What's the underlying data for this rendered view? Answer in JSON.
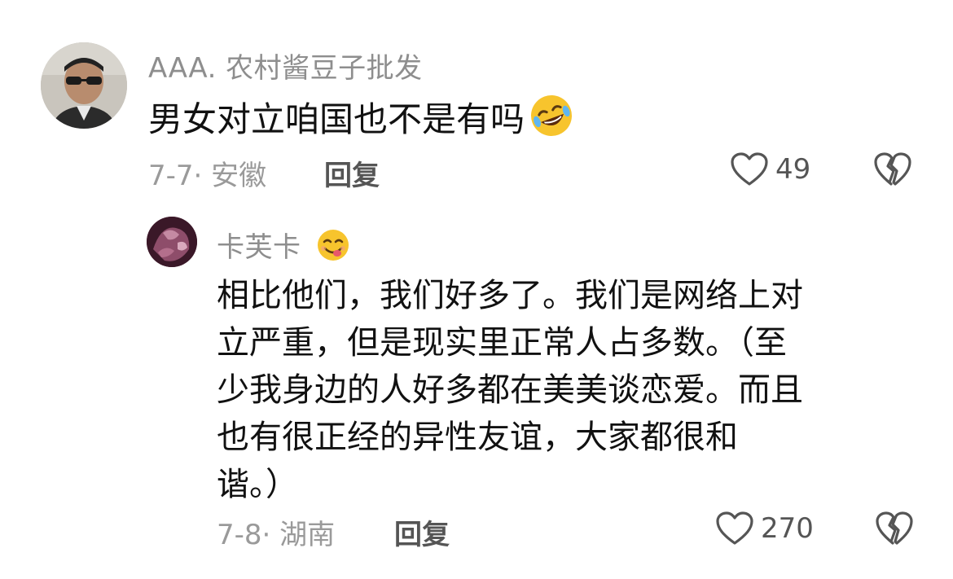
{
  "comments": [
    {
      "username": "AAA. 农村酱豆子批发",
      "text": "男女对立咱国也不是有吗",
      "emoji": "rofl-emoji",
      "date_location": "7-7· 安徽",
      "reply_label": "回复",
      "likes": "49"
    }
  ],
  "reply": {
    "username": "卡芙卡",
    "username_emoji": "yum-emoji",
    "text_lines": [
      "相比他们，我们好多了。我们是网络上对",
      "立严重，但是现实里正常人占多数。（至",
      "少我身边的人好多都在美美谈恋爱。而且",
      "也有很正经的异性友谊，大家都很和",
      "谐。）"
    ],
    "date_location": "7-8· 湖南",
    "reply_label": "回复",
    "likes": "270"
  },
  "icons": {
    "like": "heart-outline-icon",
    "dislike": "broken-heart-icon"
  }
}
